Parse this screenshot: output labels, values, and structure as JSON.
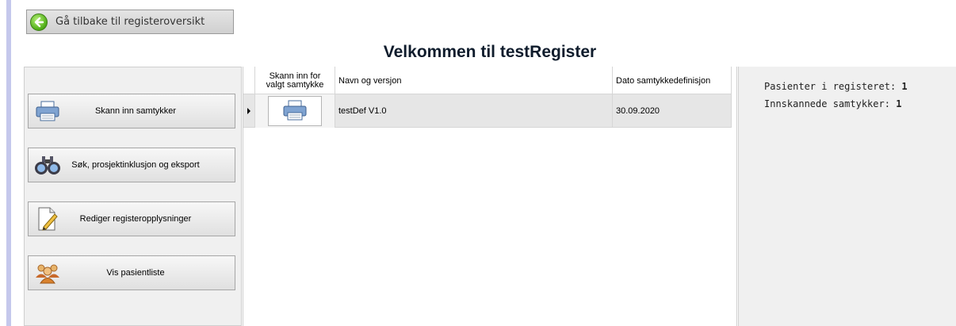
{
  "back_button": {
    "label": "Gå tilbake til registeroversikt",
    "icon": "back-arrow-icon"
  },
  "page_title": "Velkommen til testRegister",
  "actions": [
    {
      "label": "Skann inn samtykker",
      "icon": "printer-icon"
    },
    {
      "label": "Søk, prosjektinklusjon og eksport",
      "icon": "binoculars-icon"
    },
    {
      "label": "Rediger registeropplysninger",
      "icon": "edit-document-icon"
    },
    {
      "label": "Vis pasientliste",
      "icon": "patients-icon"
    }
  ],
  "grid": {
    "columns": [
      "Skann inn for\nvalgt samtykke",
      "Navn og versjon",
      "Dato samtykkedefinisjon"
    ],
    "rows": [
      {
        "scan_icon": "printer-icon",
        "name": "testDef V1.0",
        "date": "30.09.2020"
      }
    ]
  },
  "stats": {
    "patients_label": "Pasienter i registeret:",
    "patients_value": "1",
    "scanned_label": "Innskannede samtykker:",
    "scanned_value": "1"
  }
}
